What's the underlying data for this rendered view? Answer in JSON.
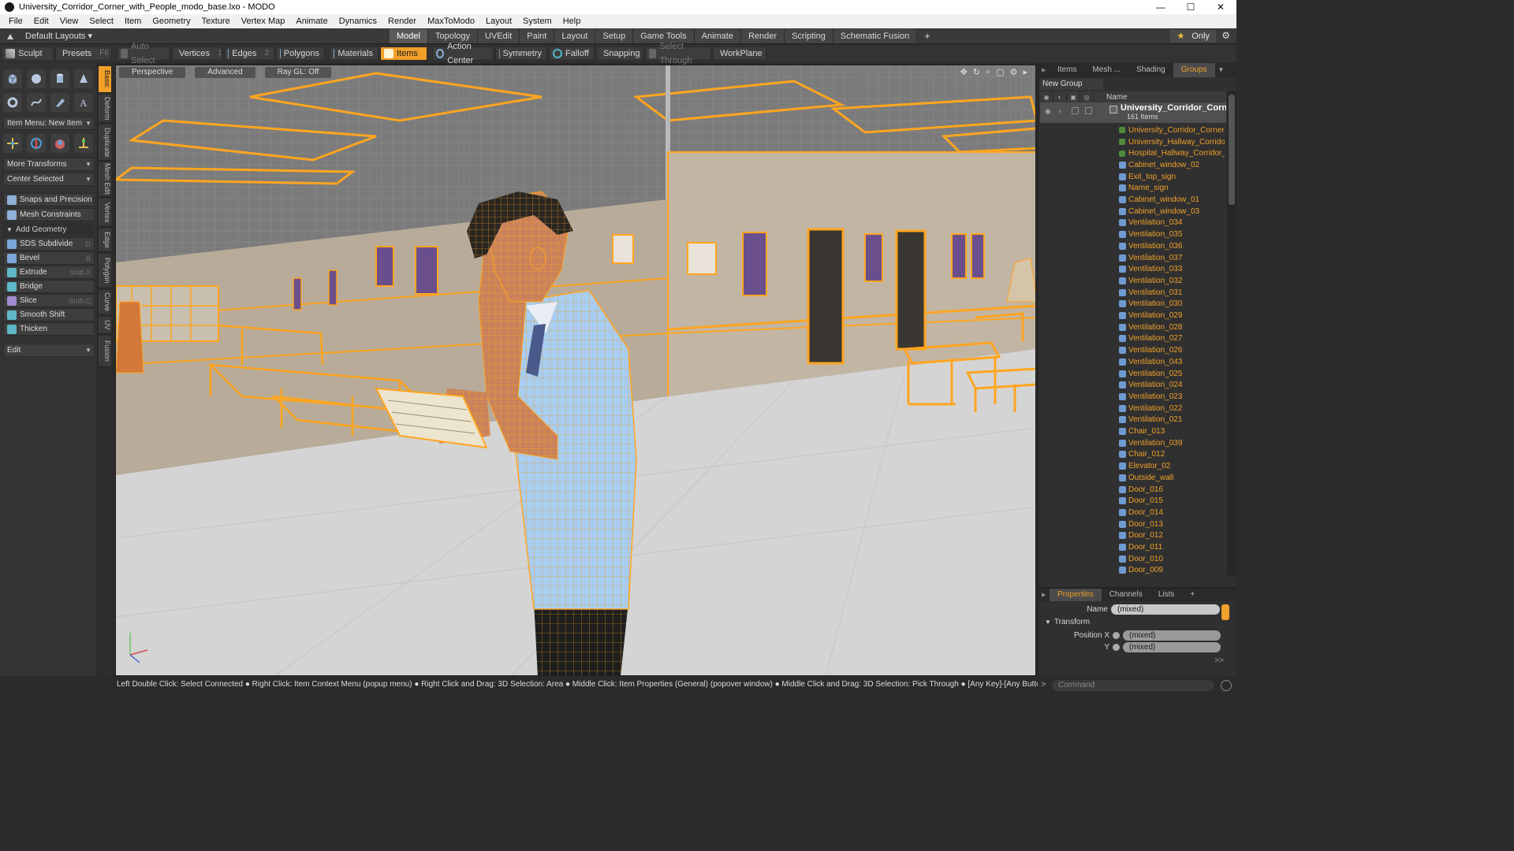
{
  "window": {
    "title": "University_Corridor_Corner_with_People_modo_base.lxo - MODO",
    "minimize": "—",
    "maximize": "☐",
    "close": "✕"
  },
  "menu": [
    "File",
    "Edit",
    "View",
    "Select",
    "Item",
    "Geometry",
    "Texture",
    "Vertex Map",
    "Animate",
    "Dynamics",
    "Render",
    "MaxToModo",
    "Layout",
    "System",
    "Help"
  ],
  "layoutbar": {
    "layout_label": "Default Layouts ▾",
    "tabs": [
      "Model",
      "Topology",
      "UVEdit",
      "Paint",
      "Layout",
      "Setup",
      "Game Tools",
      "Animate",
      "Render",
      "Scripting",
      "Schematic Fusion"
    ],
    "active_tab": "Model",
    "add_tab": "+",
    "only_label": "Only",
    "only_star": "★",
    "gear": "⚙"
  },
  "toolbar": {
    "sculpt": "Sculpt",
    "presets": "Presets",
    "presets_key": "F6",
    "auto_select": "Auto Select",
    "vertices": "Vertices",
    "vertices_num": "1",
    "edges": "Edges",
    "edges_num": "2",
    "polygons": "Polygons",
    "materials": "Materials",
    "items": "Items",
    "action_center": "Action Center",
    "symmetry": "Symmetry",
    "falloff": "Falloff",
    "snapping": "Snapping",
    "select_through": "Select Through",
    "workplane": "WorkPlane"
  },
  "leftpanel": {
    "item_menu": "Item Menu: New Item",
    "more_transforms": "More Transforms",
    "center_selected": "Center Selected",
    "snaps_precision": "Snaps and Precision",
    "mesh_constraints": "Mesh Constraints",
    "add_geometry": "Add Geometry",
    "tools": [
      {
        "label": "SDS Subdivide",
        "key": "D"
      },
      {
        "label": "Bevel",
        "key": "B"
      },
      {
        "label": "Extrude",
        "key": "Shift-X"
      },
      {
        "label": "Bridge",
        "key": ""
      },
      {
        "label": "Slice",
        "key": "Shift-C"
      },
      {
        "label": "Smooth Shift",
        "key": ""
      },
      {
        "label": "Thicken",
        "key": ""
      }
    ],
    "edit": "Edit"
  },
  "vtabs": [
    "Basic",
    "Deform",
    "Duplicate",
    "Mesh Edit",
    "Vertex",
    "Edge",
    "Polygon",
    "Curve",
    "UV",
    "Fusion"
  ],
  "viewport": {
    "perspective": "Perspective",
    "advanced": "Advanced",
    "raygl": "Ray GL: Off"
  },
  "statusbar": "Left Double Click: Select Connected ● Right Click: Item Context Menu (popup menu) ● Right Click and Drag: 3D Selection: Area ● Middle Click: Item Properties (General) (popover window) ● Middle Click and Drag: 3D Selection: Pick Through ● [Any Key]-[Any Button] Click and Drag: dragDrop...",
  "rightpanel": {
    "tabs": [
      "Items",
      "Mesh ...",
      "Shading",
      "Groups"
    ],
    "active_tab": "Groups",
    "new_group": "New Group",
    "name_col": "Name",
    "root_name": "University_Corridor_Corn...",
    "root_count": "161 Items",
    "items": [
      "University_Corridor_Corner ...",
      "University_Hallway_Corrido...",
      "Hospital_Hallway_Corridor_...",
      "Cabinet_window_02",
      "Exit_top_sign",
      "Name_sign",
      "Cabinet_window_01",
      "Cabinet_window_03",
      "Ventilation_034",
      "Ventilation_035",
      "Ventilation_036",
      "Ventilation_037",
      "Ventilation_033",
      "Ventilation_032",
      "Ventilation_031",
      "Ventilation_030",
      "Ventilation_029",
      "Ventilation_028",
      "Ventilation_027",
      "Ventilation_026",
      "Ventilation_043",
      "Ventilation_025",
      "Ventilation_024",
      "Ventilation_023",
      "Ventilation_022",
      "Ventilation_021",
      "Chair_013",
      "Ventilation_039",
      "Chair_012",
      "Elevator_02",
      "Outside_wall",
      "Door_016",
      "Door_015",
      "Door_014",
      "Door_013",
      "Door_012",
      "Door_011",
      "Door_010",
      "Door_009"
    ]
  },
  "properties": {
    "tabs": [
      "Properties",
      "Channels",
      "Lists",
      "+"
    ],
    "active_tab": "Properties",
    "name_label": "Name",
    "name_value": "(mixed)",
    "transform": "Transform",
    "posx_label": "Position X",
    "posx_value": "(mixed)",
    "y_label": "Y",
    "y_value": "(mixed)",
    "more": ">>"
  },
  "command": {
    "placeholder": "Command"
  },
  "colors": {
    "accent": "#f1a02a",
    "wire": "#ffa51f"
  }
}
